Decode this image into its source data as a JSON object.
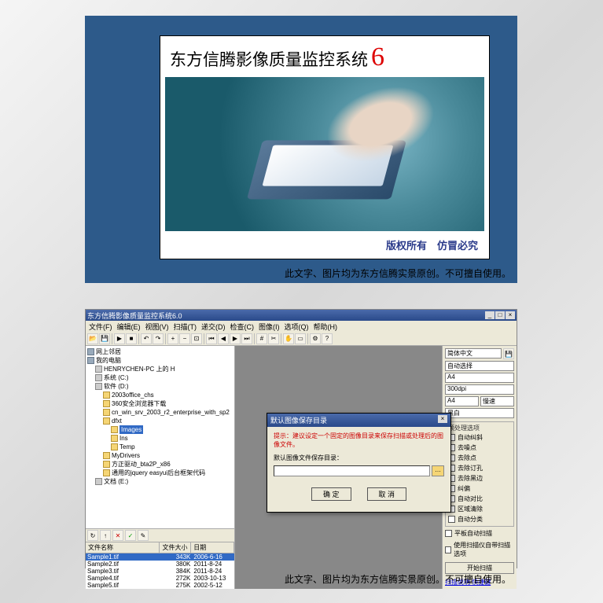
{
  "splash": {
    "title": "东方信腾影像质量监控系统",
    "version": "6",
    "copyright": "版权所有　仿冒必究",
    "watermark": "此文字、图片均为东方信腾实景原创。不可擅自使用。"
  },
  "app": {
    "title": "东方信腾影像质量监控系统6.0",
    "watermark": "此文字、图片均为东方信腾实景原创。不可擅自使用。",
    "menu": [
      "文件(F)",
      "编辑(E)",
      "视图(V)",
      "扫描(T)",
      "递交(D)",
      "检查(C)",
      "图像(I)",
      "选项(Q)",
      "帮助(H)"
    ],
    "tree": {
      "net": "网上邻居",
      "mycomp": "我的电脑",
      "drive_h": "HENRYCHEN-PC 上的 H",
      "sys": "系统 (C:)",
      "soft": "软件 (D:)",
      "n1": "2003office_chs",
      "n2": "360安全浏览器下载",
      "n3": "cn_win_srv_2003_r2_enterprise_with_sp2",
      "n4": "dfxt",
      "n4a": "Images",
      "n4b": "Ins",
      "n4c": "Temp",
      "n5": "MyDrivers",
      "n6": "方正驱动_bta2P_x86",
      "n7": "通用的jquery easyui后台框架代码",
      "doc": "文档 (E:)"
    },
    "filelist": {
      "headers": [
        "文件名称",
        "文件大小",
        "日期"
      ],
      "rows": [
        [
          "Sample1.tif",
          "343K",
          "2006-6-16"
        ],
        [
          "Sample2.tif",
          "380K",
          "2011-8-24"
        ],
        [
          "Sample3.tif",
          "384K",
          "2011-8-24"
        ],
        [
          "Sample4.tif",
          "272K",
          "2003-10-13"
        ],
        [
          "Sample5.tif",
          "275K",
          "2002-5-12"
        ]
      ]
    },
    "right": {
      "lang": "简体中文",
      "drv": "自动选择",
      "paper": "A4",
      "dpi": "300dpi",
      "mode": "慢速",
      "gray": "黑白",
      "opts_title": "预处理选项",
      "opts": [
        "自动纠斜",
        "去噪点",
        "去除点",
        "去除订孔",
        "去除黑边",
        "纠偏",
        "自动对比",
        "区域清除",
        "自动分类"
      ],
      "cb_flat": "平板自动扫描",
      "cb_adf": "使用扫描仪自带扫描选项",
      "btn_scan": "开始扫描",
      "links": "扫描说明 快捷键"
    },
    "dialog": {
      "title": "默认图像保存目录",
      "hint": "提示：建议设定一个固定的图像目录来保存扫描或处理后的图像文件。",
      "label": "默认图像文件保存目录：",
      "ok": "确  定",
      "cancel": "取  消"
    }
  }
}
